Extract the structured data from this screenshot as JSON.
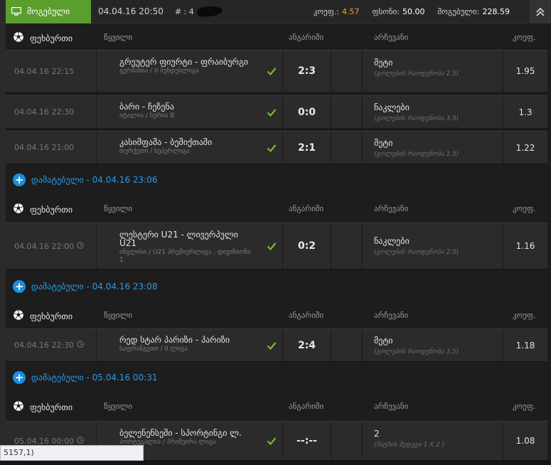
{
  "topbar": {
    "status_label": "მოგებული",
    "date": "04.04.16 20:50",
    "ticket_prefix": "# : 4",
    "coef_label": "კოეფ.:",
    "coef_value": "4.57",
    "stake_label": "ფსონი:",
    "stake_value": "50.00",
    "win_label": "მოგებული:",
    "win_value": "228.59"
  },
  "headers": {
    "sport": "ფეხბურთი",
    "event": "წყვილი",
    "score": "ანგარიში",
    "selection": "არჩევანი",
    "coef": "კოეფ."
  },
  "bets": [
    {
      "date": "04.04.16 22:15",
      "name": "გრეუტერ ფიურტი - ფრაიბურგი",
      "league": "გერმანია / II ბუნდესლიგა",
      "score": "2:3",
      "pick": "მეტი",
      "market": "(გოლების რაოდენობა 2.5)",
      "odd": "1.95"
    },
    {
      "date": "04.04.16 22:30",
      "name": "ბარი - ჩეზენა",
      "league": "იტალია / სერია B",
      "score": "0:0",
      "pick": "ნაკლები",
      "market": "(გოლების რაოდენობა 3.5)",
      "odd": "1.3"
    },
    {
      "date": "04.04.16 21:00",
      "name": "კასიმფაშა - ბეშიქთაში",
      "league": "თურქეთი / სუპერლიგა",
      "score": "2:1",
      "pick": "მეტი",
      "market": "(გოლების რაოდენობა 1.5)",
      "odd": "1.22"
    },
    {
      "date": "04.04.16 22:00",
      "name": "ლესტერი U21 - ლივერპული U21",
      "league": "ინგლისი / U21 პრემიერლიგა , დივიზიონი 1",
      "score": "0:2",
      "pick": "ნაკლები",
      "market": "(გოლების რაოდენობა 2.5)",
      "odd": "1.16"
    },
    {
      "date": "04.04.16 22:30",
      "name": "რედ სტარ პარიზი - პარიზი",
      "league": "საფრანგეთი / II ლიგა",
      "score": "2:4",
      "pick": "მეტი",
      "market": "(გოლების რაოდენობა 3.5)",
      "odd": "1.18"
    },
    {
      "date": "05.04.16 00:00",
      "name": "ბელენენსეში - სპორტინგი ლ.",
      "league": "პორტუგალია / პრიმეირა ლიგა",
      "score": "--:--",
      "pick": "2",
      "market": "(მატჩის შედეგი 1 X 2 )",
      "odd": "1.08"
    }
  ],
  "added": [
    {
      "label": "დამატებული - 04.04.16 23:06"
    },
    {
      "label": "დამატებული - 04.04.16 23:08"
    },
    {
      "label": "დამატებული - 05.04.16 00:31"
    }
  ],
  "status_bar": "5157,1)",
  "colors": {
    "won": "#5a9e2e",
    "accent_blue": "#1a8fe0",
    "coef_orange": "#f0a020",
    "check_green": "#6fbf2f"
  }
}
